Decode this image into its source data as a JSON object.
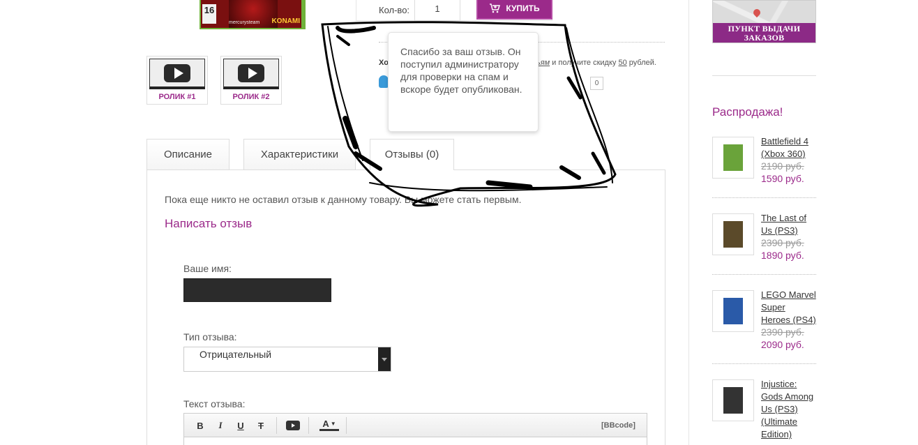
{
  "product": {
    "cover_rating": "16",
    "cover_publisher": "mercurysteam",
    "cover_brand": "KONAMI",
    "qty_label": "Кол-во:",
    "qty_value": "1",
    "buy_label": "КУПИТЬ",
    "promo_lead": "Хо",
    "promo_mid": "ьям",
    "promo_tail": " и получите скидку ",
    "promo_amount": "50",
    "promo_end": " рублей.",
    "share_count": "0"
  },
  "videos": [
    {
      "label": "РОЛИК #1"
    },
    {
      "label": "РОЛИК #2"
    }
  ],
  "tabs": [
    {
      "label": "Описание"
    },
    {
      "label": "Характеристики"
    },
    {
      "label": "Отзывы (0)"
    }
  ],
  "reviews": {
    "empty_text": "Пока еще никто не оставил отзыв к данному товару. Вы можете стать первым.",
    "write_link": "Написать отзыв",
    "name_label": "Ваше имя:",
    "type_label": "Тип отзыва:",
    "type_value": "Отрицательный",
    "text_label": "Текст отзыва:",
    "toolbar": {
      "bold": "B",
      "italic": "I",
      "underline": "U",
      "strike": "T",
      "color": "A",
      "bbcode": "[BBcode]"
    }
  },
  "tooltip": {
    "message": "Спасибо за ваш отзыв. Он поступил администратору для проверки на спам и вскоре будет опубликован."
  },
  "sidebar": {
    "map_banner_line1": "ПУНКТ ВЫДАЧИ",
    "map_banner_line2": "ЗАКАЗОВ",
    "sale_title": "Распродажа!",
    "sale_items": [
      {
        "name": "Battlefield 4 (Xbox 360)",
        "old_price": "2190 руб.",
        "new_price": "1590 руб.",
        "color": "#6aa33a"
      },
      {
        "name": "The Last of Us (PS3)",
        "old_price": "2390 руб.",
        "new_price": "1890 руб.",
        "color": "#5b4a2a"
      },
      {
        "name": "LEGO Marvel Super Heroes (PS4)",
        "old_price": "2390 руб.",
        "new_price": "2090 руб.",
        "color": "#2a5aa8"
      },
      {
        "name": "Injustice: Gods Among Us (PS3) (Ultimate Edition)",
        "old_price": "",
        "new_price": "",
        "color": "#333333"
      }
    ]
  }
}
